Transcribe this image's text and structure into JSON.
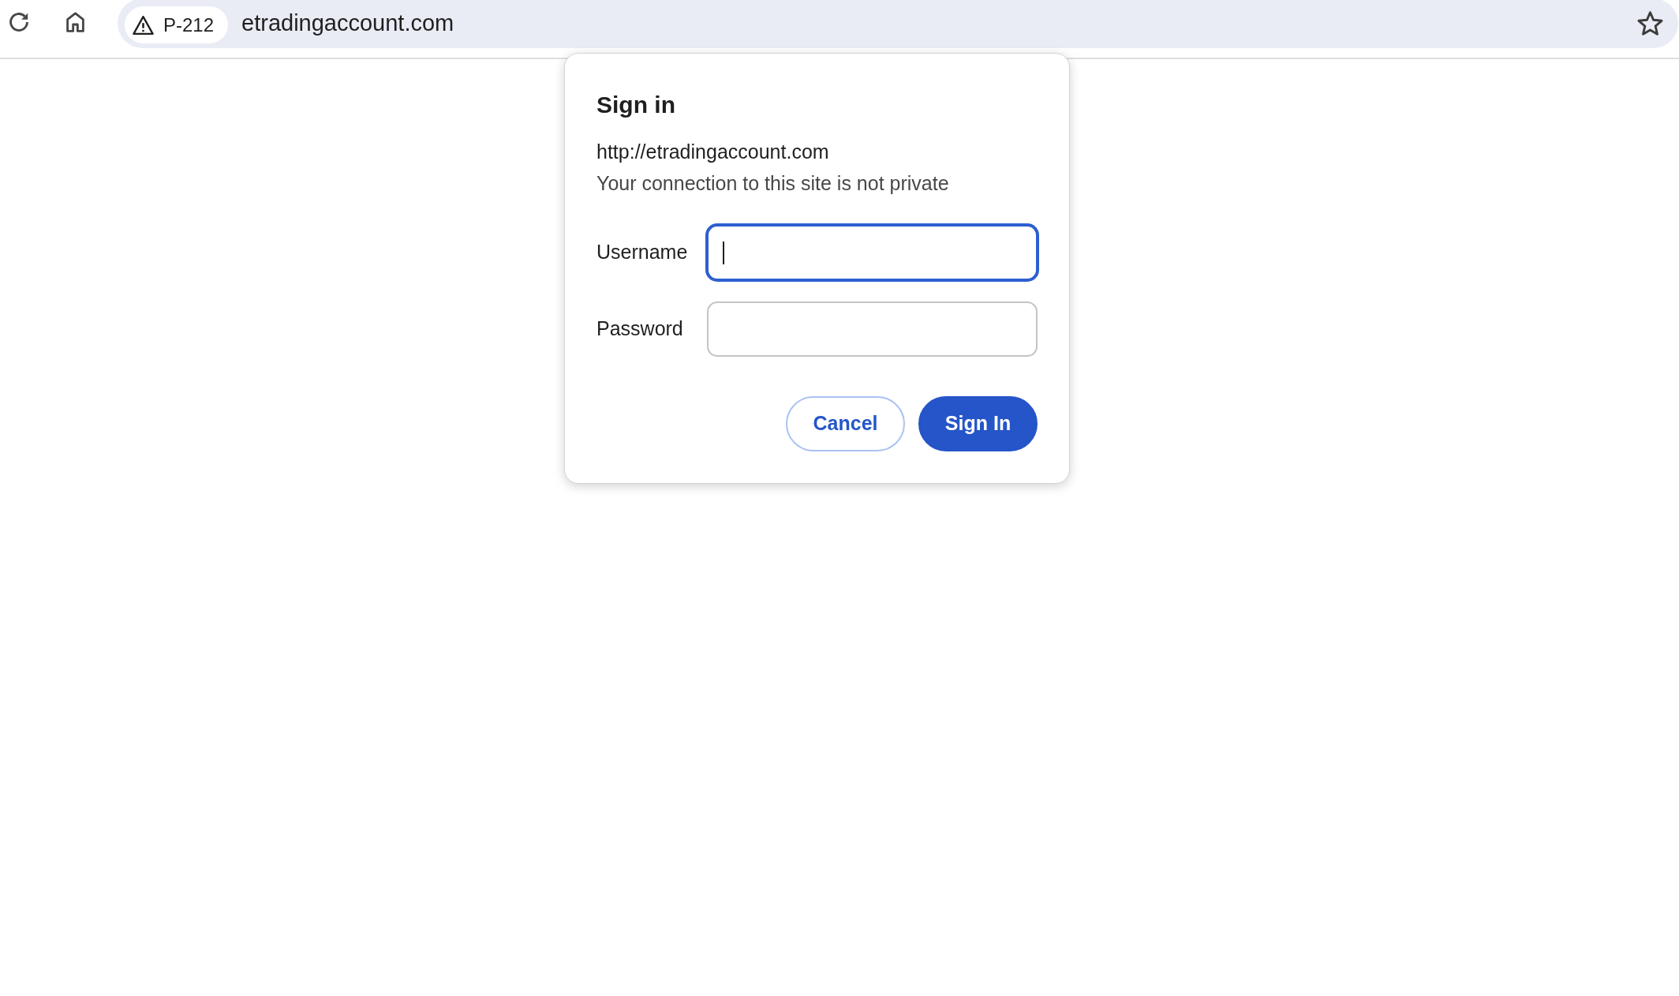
{
  "toolbar": {
    "address_bar": {
      "site_chip": {
        "label": "P-212"
      },
      "url": "etradingaccount.com"
    }
  },
  "dialog": {
    "title": "Sign in",
    "origin": "http://etradingaccount.com",
    "notice": "Your connection to this site is not private",
    "fields": [
      {
        "label": "Username",
        "focused": true
      },
      {
        "label": "Password",
        "focused": false
      }
    ],
    "buttons": [
      {
        "label": "Cancel",
        "kind": "secondary"
      },
      {
        "label": "Sign In",
        "kind": "primary"
      }
    ]
  }
}
